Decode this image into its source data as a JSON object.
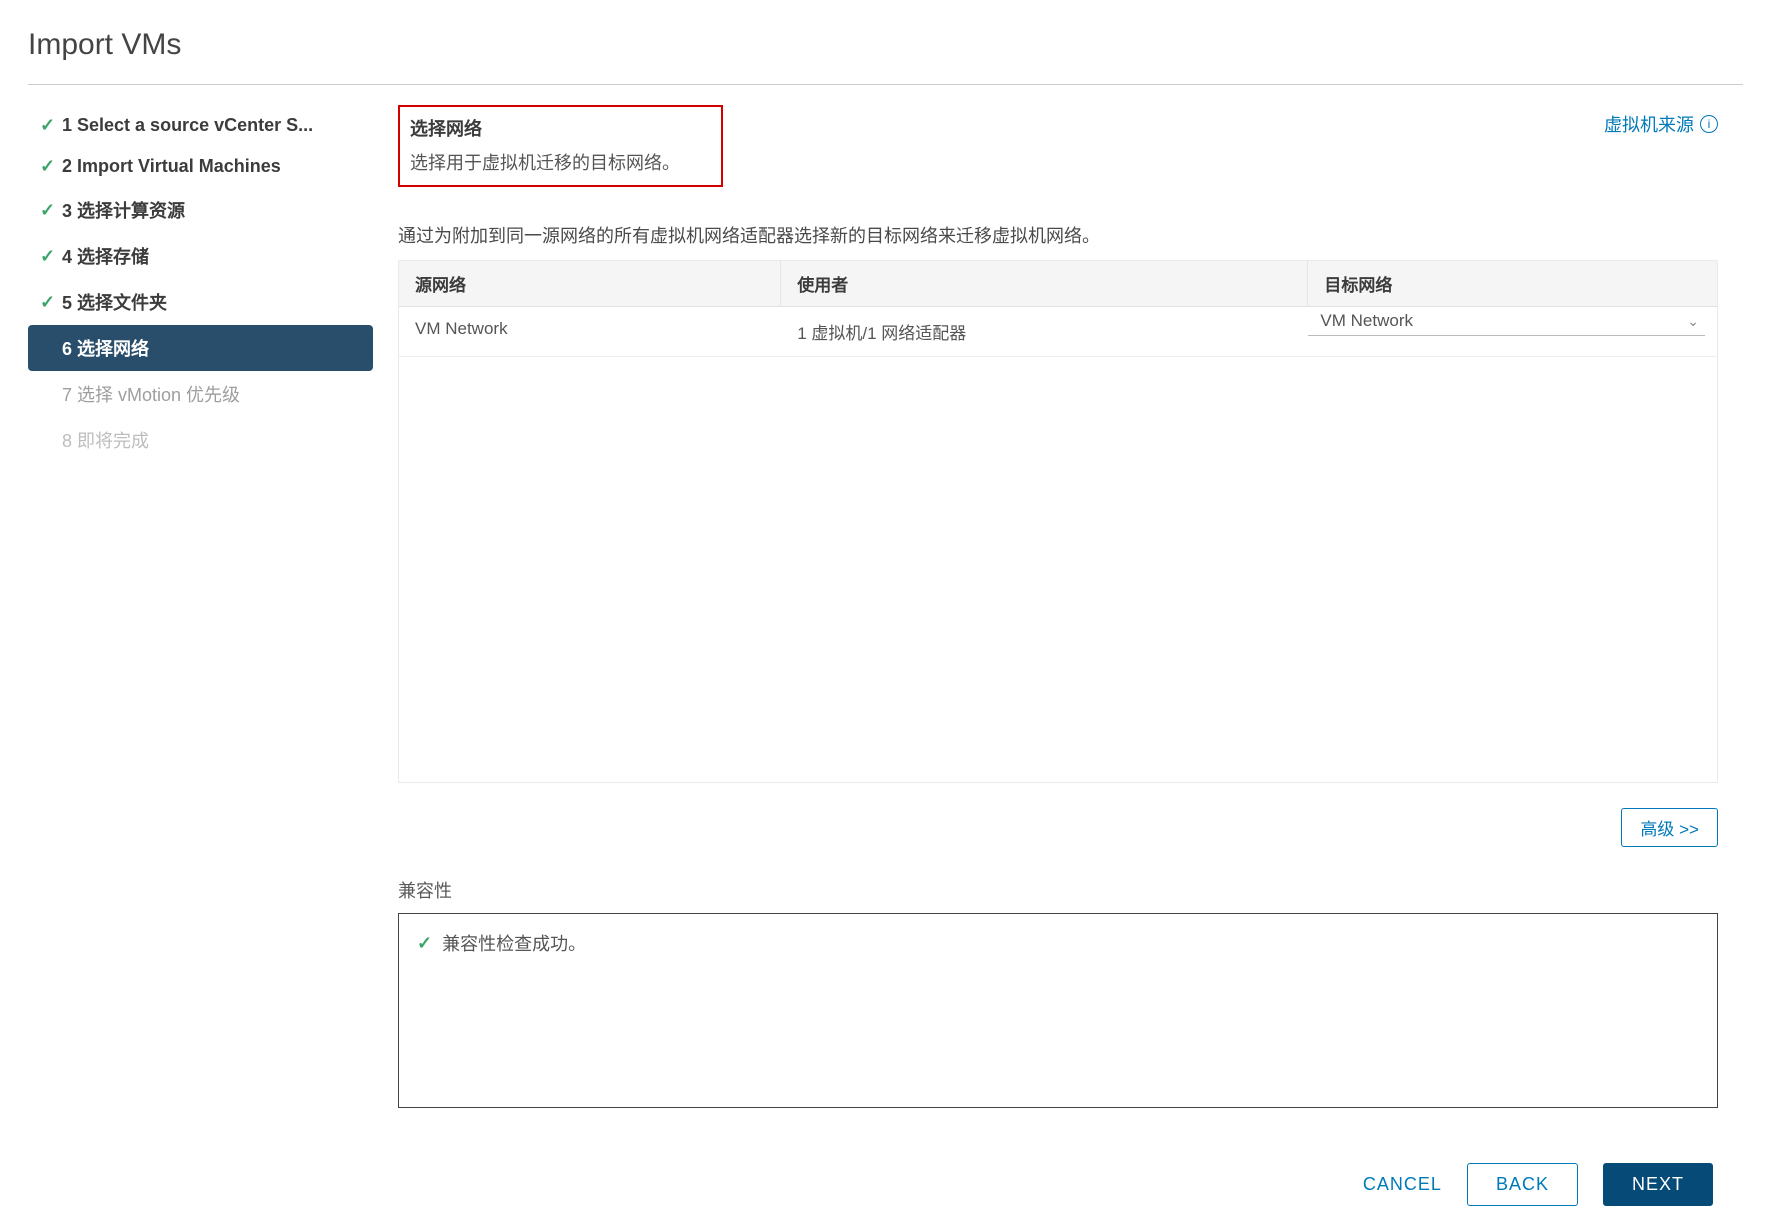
{
  "dialog_title": "Import VMs",
  "steps": [
    {
      "label": "1 Select a source vCenter S...",
      "state": "done"
    },
    {
      "label": "2 Import Virtual Machines",
      "state": "done"
    },
    {
      "label": "3 选择计算资源",
      "state": "done"
    },
    {
      "label": "4 选择存储",
      "state": "done"
    },
    {
      "label": "5 选择文件夹",
      "state": "done"
    },
    {
      "label": "6 选择网络",
      "state": "active"
    },
    {
      "label": "7 选择 vMotion 优先级",
      "state": "upcoming"
    },
    {
      "label": "8 即将完成",
      "state": "upcoming"
    }
  ],
  "panel": {
    "title": "选择网络",
    "subtitle": "选择用于虚拟机迁移的目标网络。",
    "source_link": "虚拟机来源",
    "instruction": "通过为附加到同一源网络的所有虚拟机网络适配器选择新的目标网络来迁移虚拟机网络。"
  },
  "table": {
    "headers": {
      "source": "源网络",
      "used_by": "使用者",
      "dest": "目标网络"
    },
    "rows": [
      {
        "source": "VM Network",
        "used_by": "1 虚拟机/1 网络适配器",
        "dest": "VM Network"
      }
    ]
  },
  "advanced_btn": "高级 >>",
  "compat": {
    "label": "兼容性",
    "message": "兼容性检查成功。"
  },
  "footer": {
    "cancel": "CANCEL",
    "back": "BACK",
    "next": "NEXT"
  }
}
